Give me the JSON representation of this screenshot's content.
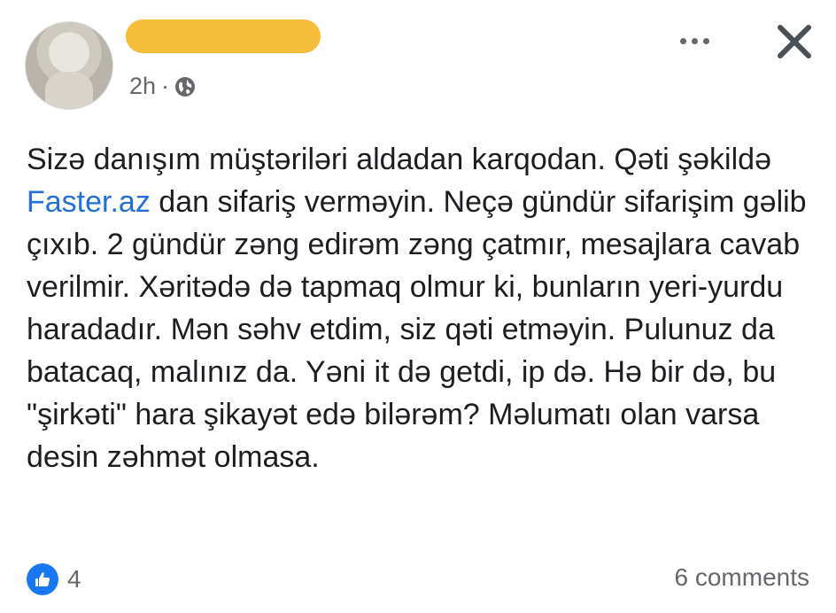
{
  "post": {
    "author": {
      "name_redacted": true
    },
    "timestamp": "2h",
    "separator": "·",
    "privacy_icon": "globe-icon",
    "text": {
      "part1": "Sizə danışım müştəriləri aldadan karqodan. Qəti şəkildə ",
      "link": "Faster.az",
      "part2": " dan sifariş verməyin. Neçə gündür sifarişim gəlib çıxıb. 2 gündür zəng edirəm zəng çatmır, mesajlara cavab verilmir. Xəritədə də tapmaq olmur ki, bunların yeri-yurdu haradadır. Mən səhv etdim, siz qəti etməyin. Pulunuz da batacaq, malınız da. Yəni it də getdi, ip də. Hə bir də, bu \"şirkəti\" hara şikayət edə bilərəm? Məlumatı olan varsa desin zəhmət olmasa."
    }
  },
  "header_actions": {
    "more_icon": "more-horizontal-icon",
    "close_icon": "close-icon"
  },
  "footer": {
    "reaction_icon": "like-icon",
    "reaction_count": "4",
    "comments": "6 comments"
  },
  "colors": {
    "link": "#216fdb",
    "like": "#1877f2",
    "redaction": "#f4bd3a",
    "muted": "#65676b"
  }
}
